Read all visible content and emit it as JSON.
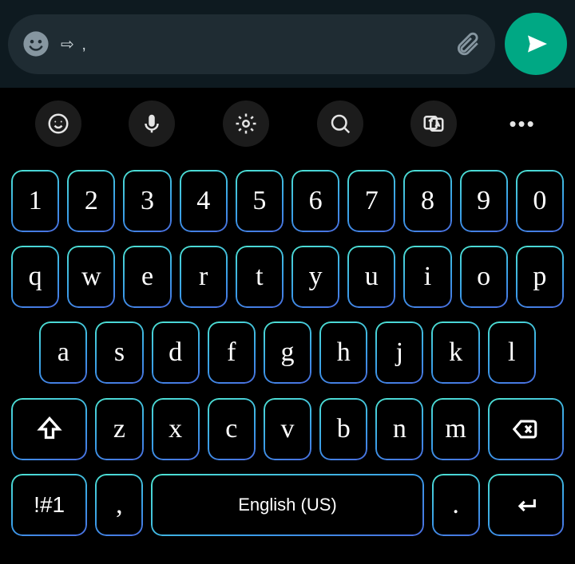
{
  "chat": {
    "message_text": "⇨ ,",
    "emoji_icon": "emoji",
    "attach_icon": "paperclip",
    "send_icon": "send"
  },
  "toolbar": {
    "items": [
      {
        "name": "sticker",
        "icon": "smile"
      },
      {
        "name": "voice",
        "icon": "mic"
      },
      {
        "name": "settings",
        "icon": "gear"
      },
      {
        "name": "search",
        "icon": "search"
      },
      {
        "name": "translate",
        "icon": "translate"
      }
    ],
    "more": "•••"
  },
  "keyboard": {
    "row1": [
      "1",
      "2",
      "3",
      "4",
      "5",
      "6",
      "7",
      "8",
      "9",
      "0"
    ],
    "row2": [
      "q",
      "w",
      "e",
      "r",
      "t",
      "y",
      "u",
      "i",
      "o",
      "p"
    ],
    "row3": [
      "a",
      "s",
      "d",
      "f",
      "g",
      "h",
      "j",
      "k",
      "l"
    ],
    "row4_letters": [
      "z",
      "x",
      "c",
      "v",
      "b",
      "n",
      "m"
    ],
    "shift": "⇧",
    "backspace": "⌫",
    "symbols_key": "!#1",
    "comma": ",",
    "space_label": "English (US)",
    "period": ".",
    "enter": "↵"
  }
}
